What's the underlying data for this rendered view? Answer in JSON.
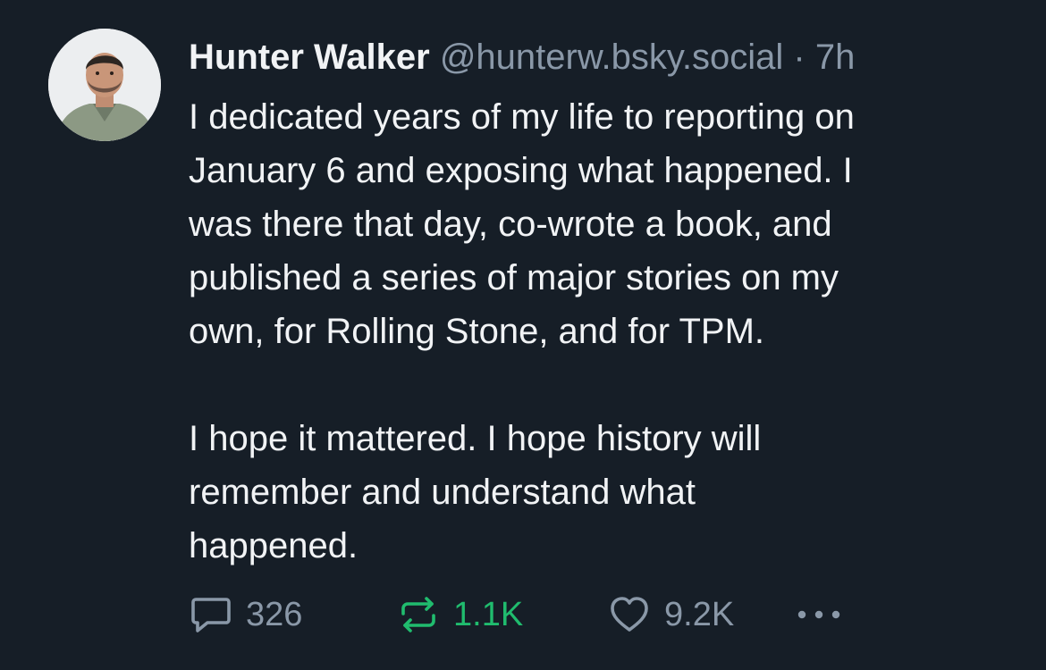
{
  "author": {
    "display_name": "Hunter Walker",
    "handle": "@hunterw.bsky.social",
    "separator": "·",
    "time": "7h",
    "avatar_icon": "profile-photo"
  },
  "post": {
    "paragraphs": [
      "I dedicated years of my life to reporting on\nJanuary 6 and exposing what happened. I\nwas there that day, co-wrote a book, and\npublished a series of major stories on my\nown, for Rolling Stone, and for TPM.",
      "I hope it mattered. I hope history will\nremember and understand what\nhappened."
    ]
  },
  "actions": {
    "reply": {
      "icon": "comment-icon",
      "count": "326"
    },
    "repost": {
      "icon": "repost-icon",
      "count": "1.1K",
      "active_color": "#20bc6e"
    },
    "like": {
      "icon": "heart-icon",
      "count": "9.2K"
    },
    "more": {
      "icon": "more-icon"
    }
  },
  "colors": {
    "background": "#161e27",
    "text": "#f1f3f5",
    "muted": "#8a98a8"
  }
}
